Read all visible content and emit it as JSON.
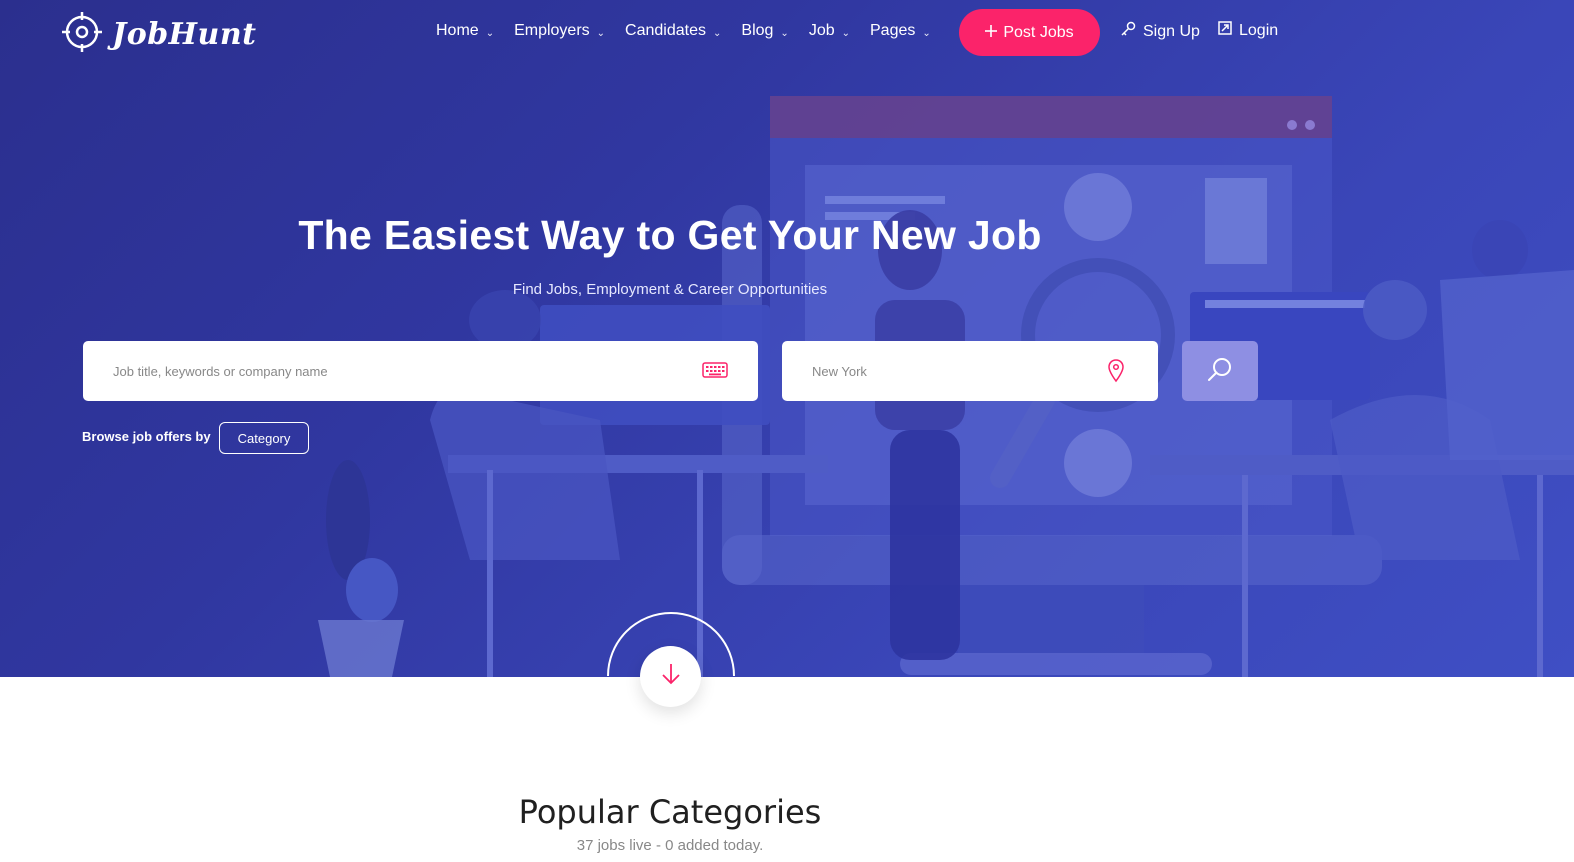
{
  "brand": {
    "name": "JobHunt",
    "logo_icon": "crosshair-icon"
  },
  "nav": {
    "items": [
      {
        "label": "Home"
      },
      {
        "label": "Employers"
      },
      {
        "label": "Candidates"
      },
      {
        "label": "Blog"
      },
      {
        "label": "Job"
      },
      {
        "label": "Pages"
      }
    ],
    "dropdown_icon": "chevron-down-icon"
  },
  "header": {
    "post_jobs_label": "Post Jobs",
    "post_jobs_icon": "plus-icon",
    "signup_label": "Sign Up",
    "signup_icon": "key-icon",
    "login_label": "Login",
    "login_icon": "external-link-icon"
  },
  "hero": {
    "title": "The Easiest Way to Get Your New Job",
    "subtitle": "Find Jobs, Employment & Career Opportunities",
    "keyword_placeholder": "Job title, keywords or company name",
    "keyword_icon": "keyboard-icon",
    "location_value": "New York",
    "location_icon": "map-pin-icon",
    "search_icon": "search-icon",
    "browse_label": "Browse job offers by",
    "category_label": "Category",
    "scroll_icon": "arrow-down-icon"
  },
  "categories": {
    "title": "Popular Categories",
    "subtitle": "37 jobs live - 0 added today."
  },
  "colors": {
    "hero_bg": "#3037a0",
    "accent": "#fb236a",
    "search_button": "#8e8fe3"
  }
}
